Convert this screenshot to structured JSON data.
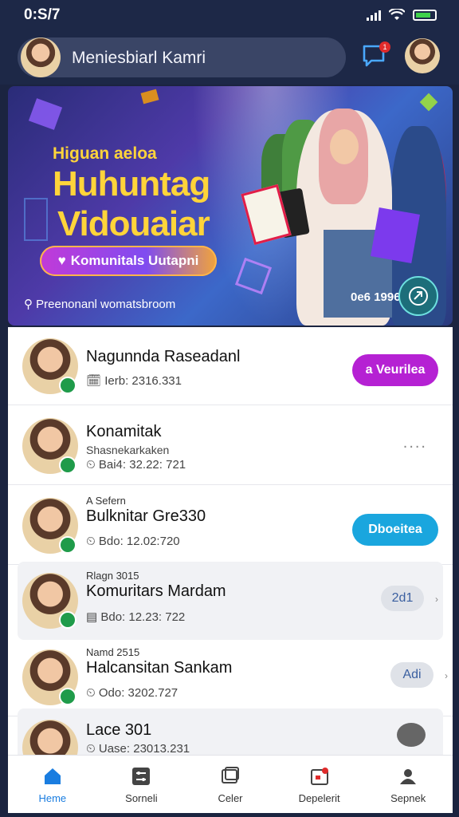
{
  "status": {
    "time": "0:S/7"
  },
  "header": {
    "title": "Meniesbiarl Kamri",
    "notif_count": "1"
  },
  "hero": {
    "kicker": "Higuan aeloa",
    "title_line1": "Huhuntag",
    "title_line2": "Vidouaiar",
    "cta": "Komunitals Uutapni",
    "subtitle": "Preenonanl womatsbroom",
    "count": "0e6 1996"
  },
  "list": [
    {
      "kicker": "",
      "name": "Nagunnda Raseadanl",
      "sub": "",
      "meta": "Ierb: 2316.331",
      "action": "a Veurilea",
      "action_style": "purple"
    },
    {
      "kicker": "",
      "name": "Konamitak",
      "sub": "Shasnekarkaken",
      "meta": "Bai4: 32.22: 721",
      "action": "....",
      "action_style": "dots"
    },
    {
      "kicker": "A Sefern",
      "name": "Bulknitar Gre330",
      "sub": "",
      "meta": "Bdo: 12.02:720",
      "action": "Dboeitea",
      "action_style": "blue"
    },
    {
      "kicker": "Rlagn 3015",
      "name": "Komuritars Mardam",
      "sub": "",
      "meta": "Bdo: 12.23: 722",
      "action": "2d1",
      "action_style": "gray"
    },
    {
      "kicker": "Namd 2515",
      "name": "Halcansitan Sankam",
      "sub": "",
      "meta": "Odo: 3202.727",
      "action": "Adi",
      "action_style": "gray"
    },
    {
      "kicker": "",
      "name": "Lace 301",
      "sub": "",
      "meta": "Uase: 23013.231",
      "action": "",
      "action_style": "icon"
    }
  ],
  "nav": [
    {
      "label": "Heme",
      "icon": "home-icon",
      "active": true
    },
    {
      "label": "Sorneli",
      "icon": "sliders-icon",
      "active": false
    },
    {
      "label": "Celer",
      "icon": "gallery-icon",
      "active": false
    },
    {
      "label": "Depelerit",
      "icon": "calendar-badge-icon",
      "active": false
    },
    {
      "label": "Sepnek",
      "icon": "profile-icon",
      "active": false
    }
  ],
  "colors": {
    "accent": "#1a7de0",
    "purple": "#b521d3",
    "blue": "#1aa6de",
    "gold": "#ffd43a"
  }
}
